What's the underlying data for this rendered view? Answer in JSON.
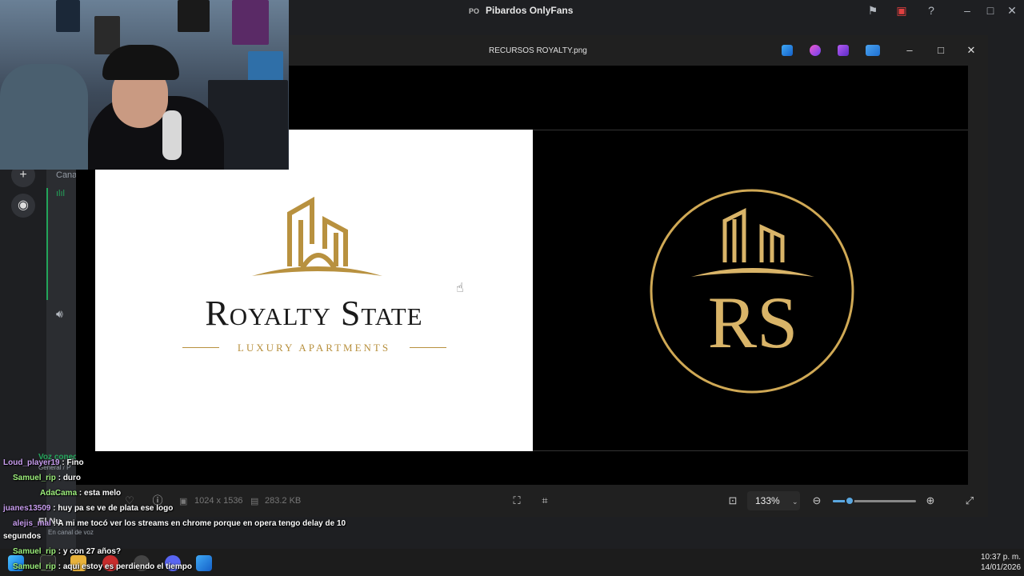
{
  "discord": {
    "server_title": "Pibardos OnlyFans",
    "server_prefix": "PO",
    "channel_label": "Canal",
    "voice_status": "Voz conectada",
    "voice_subtitle": "General / P",
    "user_name": "El Nu",
    "user_status": "En canal de voz"
  },
  "viewer": {
    "title": "RECURSOS ROYALTY.png",
    "dimensions": "1024 x 1536",
    "file_size": "283.2 KB",
    "zoom": "133%",
    "zoom_fraction": 0.2
  },
  "image": {
    "brand_name": "Royalty State",
    "brand_tagline": "LUXURY APARTMENTS",
    "monogram": "RS",
    "gold": "#b8913f"
  },
  "chat": [
    {
      "user": "Loud_player19",
      "message": "Fino"
    },
    {
      "user": "Samuel_rip",
      "message": "duro"
    },
    {
      "user": "AdaCama",
      "message": "esta melo"
    },
    {
      "user": "juanes13509",
      "message": "huy pa se ve de plata ese logo"
    },
    {
      "user": "alejis_mal",
      "message": "A mi me tocó ver los streams en chrome porque en opera tengo delay de 10"
    },
    {
      "user": "",
      "message": "segundos"
    },
    {
      "user": "Samuel_rip",
      "message": "y con 27 años?"
    },
    {
      "user": "Samuel_rip",
      "message": "aqui estoy es perdiendo el tiempo"
    }
  ],
  "taskbar": {
    "time": "10:37 p. m.",
    "date": "14/01/2026"
  }
}
